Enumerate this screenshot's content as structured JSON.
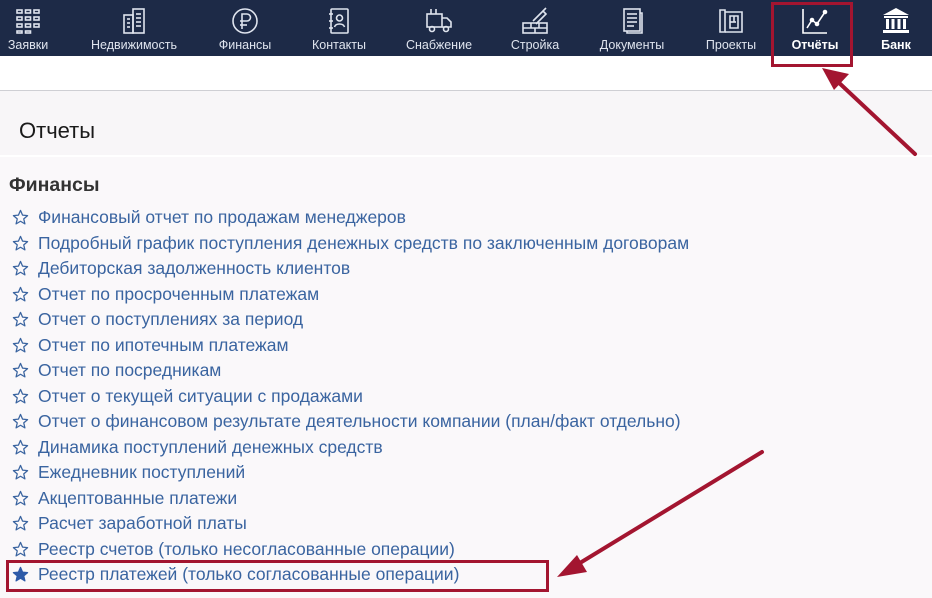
{
  "nav": {
    "items": [
      {
        "label": "Заявки"
      },
      {
        "label": "Недвижимость"
      },
      {
        "label": "Финансы"
      },
      {
        "label": "Контакты"
      },
      {
        "label": "Снабжение"
      },
      {
        "label": "Стройка"
      },
      {
        "label": "Документы"
      },
      {
        "label": "Проекты"
      },
      {
        "label": "Отчёты"
      },
      {
        "label": "Банк"
      }
    ],
    "active": "Отчёты"
  },
  "page": {
    "title": "Отчеты"
  },
  "section": {
    "title": "Финансы",
    "reports": [
      {
        "label": "Финансовый отчет по продажам менеджеров",
        "starred": false
      },
      {
        "label": "Подробный график поступления денежных средств по заключенным договорам",
        "starred": false
      },
      {
        "label": "Дебиторская задолженность клиентов",
        "starred": false
      },
      {
        "label": "Отчет по просроченным платежам",
        "starred": false
      },
      {
        "label": "Отчет о поступлениях за период",
        "starred": false
      },
      {
        "label": "Отчет по ипотечным платежам",
        "starred": false
      },
      {
        "label": "Отчет по посредникам",
        "starred": false
      },
      {
        "label": "Отчет о текущей ситуации с продажами",
        "starred": false
      },
      {
        "label": "Отчет о финансовом результате деятельности компании (план/факт отдельно)",
        "starred": false
      },
      {
        "label": "Динамика поступлений денежных средств",
        "starred": false
      },
      {
        "label": "Ежедневник поступлений",
        "starred": false
      },
      {
        "label": "Акцептованные платежи",
        "starred": false
      },
      {
        "label": "Расчет заработной платы",
        "starred": false
      },
      {
        "label": "Реестр счетов (только несогласованные операции)",
        "starred": false
      },
      {
        "label": "Реестр платежей (только согласованные операции)",
        "starred": true
      }
    ]
  },
  "colors": {
    "topbar": "#1d2a47",
    "link": "#3a64a0",
    "annotation": "#a31530",
    "star_filled": "#2e5aa8"
  }
}
